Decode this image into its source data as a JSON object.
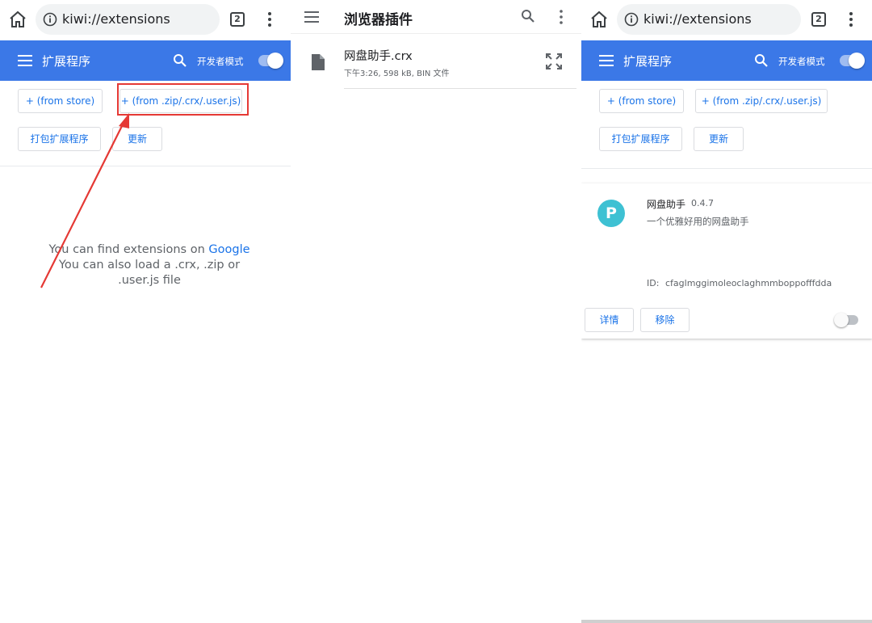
{
  "browser": {
    "url": "kiwi://extensions",
    "tab_count": "2"
  },
  "extensions_page": {
    "title": "扩展程序",
    "developer_mode_label": "开发者模式",
    "developer_mode_on": true,
    "buttons": {
      "from_store": "+ (from store)",
      "from_zip": "+ (from .zip/.crx/.user.js)",
      "pack": "打包扩展程序",
      "update": "更新"
    },
    "empty_state": {
      "line1_prefix": "You can find extensions on ",
      "line1_link": "Google",
      "line2": "You can also load a .crx, .zip or",
      "line3": ".user.js file"
    }
  },
  "download_panel": {
    "title": "浏览器插件",
    "file": {
      "name": "网盘助手.crx",
      "meta": "下午3:26, 598 kB, BIN 文件"
    }
  },
  "installed_extension": {
    "name": "网盘助手",
    "version": "0.4.7",
    "description": "一个优雅好用的网盘助手",
    "logo_letter": "P",
    "id_label": "ID:",
    "id": "cfaglmggimoleoclaghmmboppofffdda",
    "details_button": "详情",
    "remove_button": "移除",
    "enabled": false
  },
  "colors": {
    "header_blue": "#3b78e7",
    "link_blue": "#1a73e8",
    "highlight_red": "#e53935",
    "logo_teal": "#3ec1d3"
  }
}
